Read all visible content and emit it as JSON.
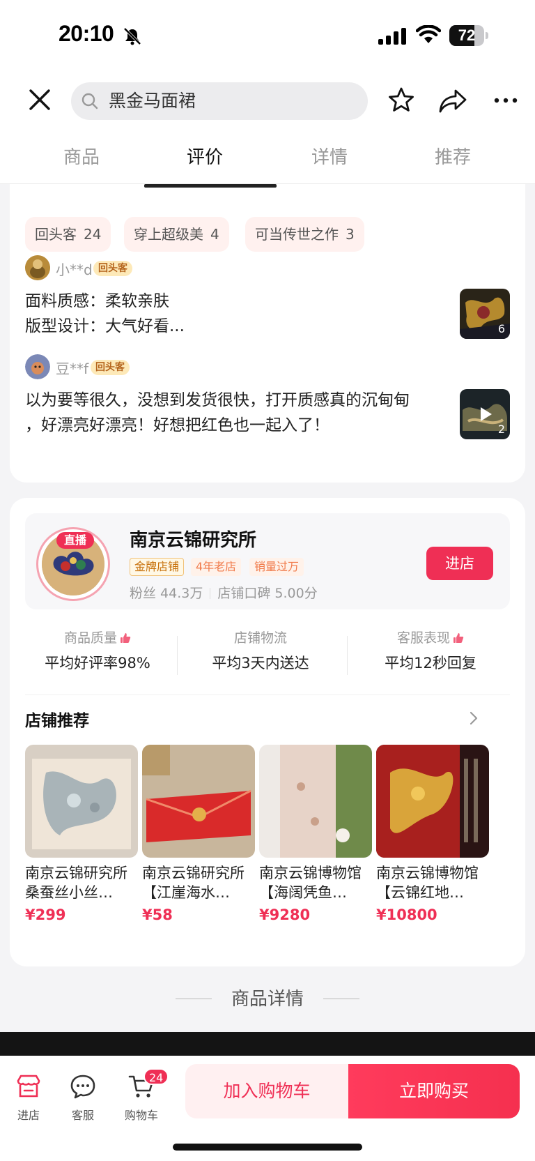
{
  "status_bar": {
    "time": "20:10",
    "battery_level": "72",
    "battery_fraction": 0.72
  },
  "header": {
    "search_placeholder": "黑金马面裙",
    "tabs": [
      {
        "label": "商品",
        "active": false
      },
      {
        "label": "评价",
        "active": true
      },
      {
        "label": "详情",
        "active": false
      },
      {
        "label": "推荐",
        "active": false
      }
    ]
  },
  "reviews": {
    "tags": [
      {
        "label": "回头客",
        "count": "24"
      },
      {
        "label": "穿上超级美",
        "count": "4"
      },
      {
        "label": "可当传世之作",
        "count": "3"
      }
    ],
    "items": [
      {
        "user": "小**d",
        "badge": "回头客",
        "lines": [
          "面料质感：柔软亲肤",
          "版型设计：大气好看..."
        ],
        "image_count": "6"
      },
      {
        "user": "豆**f",
        "badge": "回头客",
        "lines": [
          "以为要等很久，没想到发货很快，打开质感真的沉甸甸",
          "，好漂亮好漂亮！好想把红色也一起入了！"
        ],
        "image_count": "2"
      }
    ]
  },
  "store": {
    "live_label": "直播",
    "name": "南京云锦研究所",
    "badges": [
      "金牌店铺",
      "4年老店",
      "销量过万"
    ],
    "fans": "粉丝 44.3万",
    "reputation": "店铺口碑 5.00分",
    "enter_label": "进店",
    "metrics": [
      {
        "label": "商品质量",
        "value": "平均好评率98%"
      },
      {
        "label": "店铺物流",
        "value": "平均3天内送达"
      },
      {
        "label": "客服表现",
        "value": "平均12秒回复"
      }
    ],
    "recommend_title": "店铺推荐",
    "products": [
      {
        "name": "南京云锦研究所桑蚕丝小丝…",
        "price": "¥299"
      },
      {
        "name": "南京云锦研究所【江崖海水…",
        "price": "¥58"
      },
      {
        "name": "南京云锦博物馆【海阔凭鱼…",
        "price": "¥9280"
      },
      {
        "name": "南京云锦博物馆【云锦红地…",
        "price": "¥10800"
      }
    ]
  },
  "detail_section_title": "商品详情",
  "bottom_bar": {
    "store_label": "进店",
    "service_label": "客服",
    "cart_label": "购物车",
    "cart_count": "24",
    "add_to_cart": "加入购物车",
    "buy_now": "立即购买"
  },
  "colors": {
    "accent": "#ef2f55",
    "badge_bg": "#fde9b8",
    "tag_bg": "#fff1ef"
  }
}
